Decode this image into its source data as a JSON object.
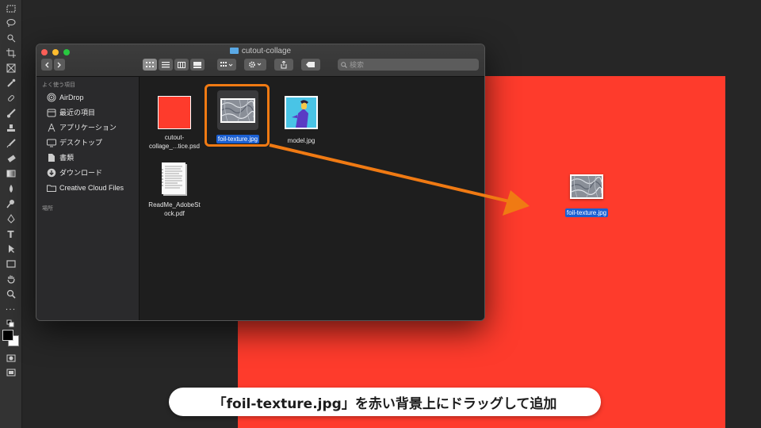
{
  "finder": {
    "title": "cutout-collage",
    "search_placeholder": "検索",
    "sidebar": {
      "favorites_header": "よく使う項目",
      "items": [
        {
          "label": "AirDrop",
          "icon": "airdrop-icon"
        },
        {
          "label": "最近の項目",
          "icon": "recents-icon"
        },
        {
          "label": "アプリケーション",
          "icon": "applications-icon"
        },
        {
          "label": "デスクトップ",
          "icon": "desktop-icon"
        },
        {
          "label": "書類",
          "icon": "documents-icon"
        },
        {
          "label": "ダウンロード",
          "icon": "downloads-icon"
        },
        {
          "label": "Creative Cloud Files",
          "icon": "folder-icon"
        }
      ],
      "locations_header": "場所"
    },
    "files": [
      {
        "name": "cutout-\ncollage_...tice.psd",
        "selected": false
      },
      {
        "name": "foil-texture.jpg",
        "selected": true
      },
      {
        "name": "model.jpg",
        "selected": false
      },
      {
        "name": "ReadMe_AdobeSt\nock.pdf",
        "selected": false
      }
    ]
  },
  "drag_ghost_label": "foil-texture.jpg",
  "caption": "「foil-texture.jpg」を赤い背景上にドラッグして追加",
  "colors": {
    "canvas": "#fe3b2c",
    "highlight": "#f07a13",
    "selection": "#1a5fd2"
  }
}
